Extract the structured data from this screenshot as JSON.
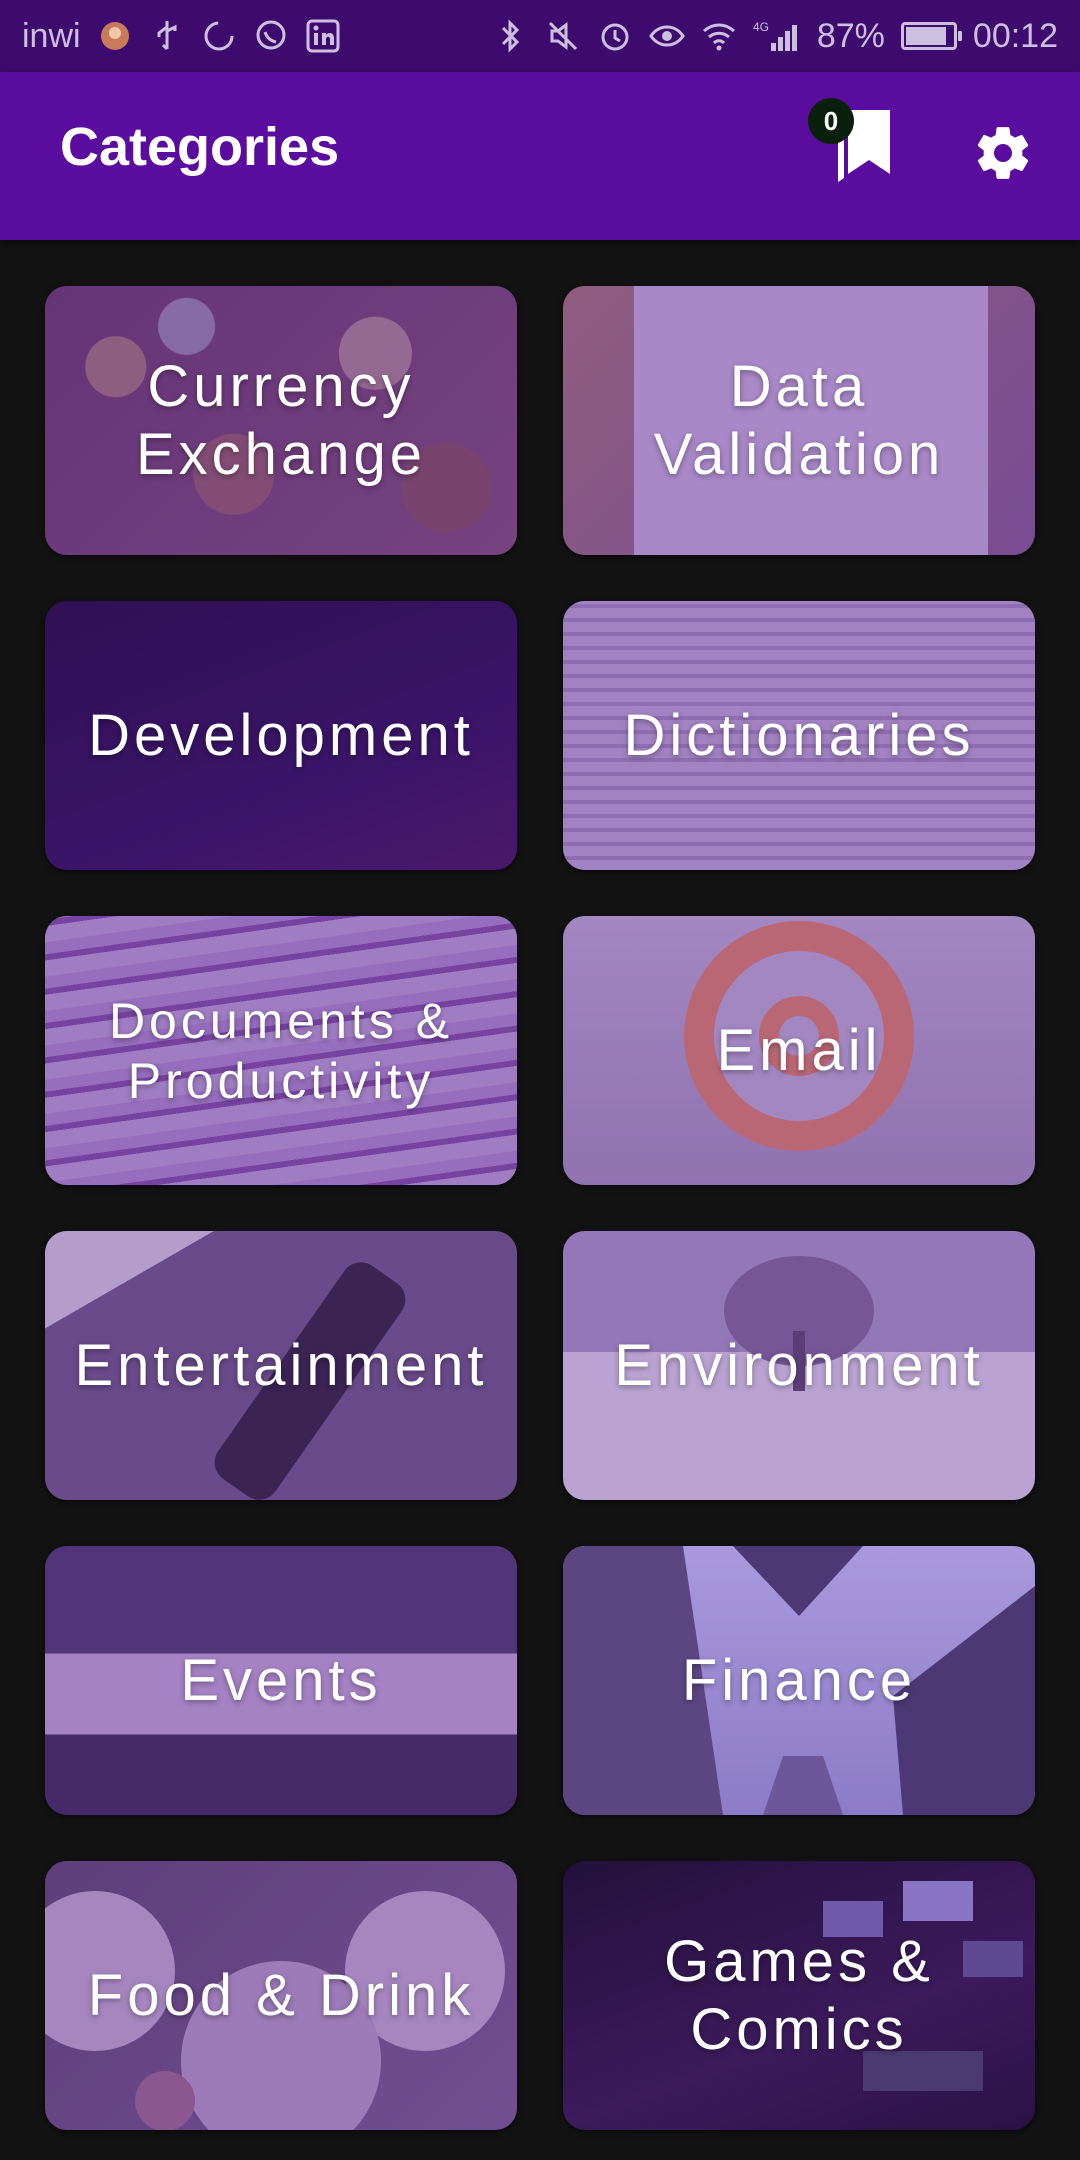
{
  "status_bar": {
    "carrier": "inwi",
    "battery": "87%",
    "battery_level": 0.87,
    "time": "00:12",
    "network": "4G",
    "icons_left": [
      "avatar-icon",
      "usb-icon",
      "sync-icon",
      "whatsapp-icon",
      "linkedin-icon"
    ],
    "icons_right": [
      "bluetooth-icon",
      "mute-icon",
      "alarm-icon",
      "eye-icon",
      "wifi-icon",
      "signal-icon",
      "battery-icon"
    ]
  },
  "app_bar": {
    "title": "Categories",
    "bookmark_count": "0",
    "colors": {
      "background": "#5a0c9e",
      "status": "#3d0a6e"
    }
  },
  "categories": [
    {
      "label": "Currency Exchange"
    },
    {
      "label": "Data Validation"
    },
    {
      "label": "Development"
    },
    {
      "label": "Dictionaries"
    },
    {
      "label": "Documents & Productivity"
    },
    {
      "label": "Email"
    },
    {
      "label": "Entertainment"
    },
    {
      "label": "Environment"
    },
    {
      "label": "Events"
    },
    {
      "label": "Finance"
    },
    {
      "label": "Food & Drink"
    },
    {
      "label": "Games & Comics"
    }
  ]
}
